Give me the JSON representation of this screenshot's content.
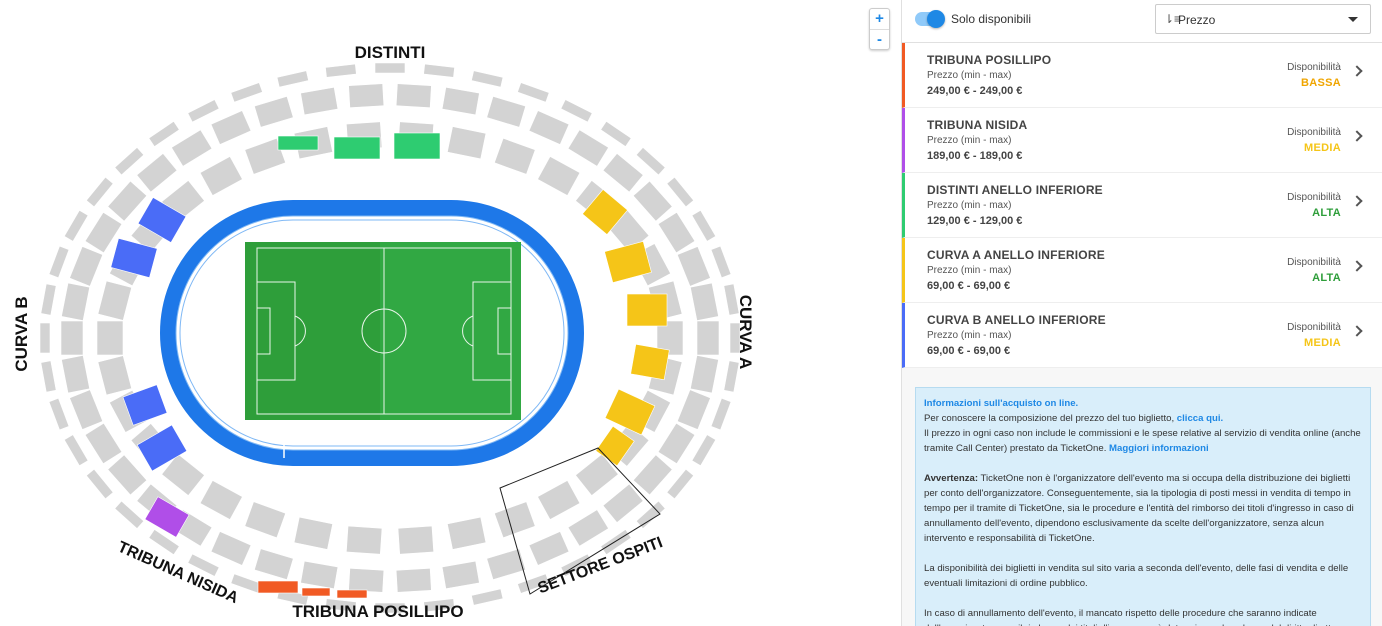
{
  "map": {
    "labels": {
      "distinti": "DISTINTI",
      "curva_b": "CURVA B",
      "curva_a": "CURVA A",
      "tribuna_nisida": "TRIBUNA NISIDA",
      "tribuna_posillipo": "TRIBUNA POSILLIPO",
      "settore_ospiti": "SETTORE OSPITI"
    },
    "zoom_in": "+",
    "zoom_out": "-",
    "colors": {
      "unavailable": "#d3d3d3",
      "distinti": "#2ecc71",
      "curva_a": "#f5c518",
      "curva_b": "#4a6cf7",
      "nisida": "#b04ee8",
      "posillipo": "#f15a24",
      "track": "#1e78e8",
      "pitch": "#2e9e3a"
    }
  },
  "filters": {
    "only_available_label": "Solo disponibili",
    "only_available_on": true,
    "sort_icon": "sort-icon",
    "sort_value": "Prezzo"
  },
  "sectors": [
    {
      "name": "TRIBUNA POSILLIPO",
      "price_label": "Prezzo (min - max)",
      "price": "249,00 € - 249,00 €",
      "avail_label": "Disponibilità",
      "avail": "BASSA",
      "avail_color": "#f0a500",
      "accent": "#f15a24"
    },
    {
      "name": "TRIBUNA NISIDA",
      "price_label": "Prezzo (min - max)",
      "price": "189,00 € - 189,00 €",
      "avail_label": "Disponibilità",
      "avail": "MEDIA",
      "avail_color": "#f5c518",
      "accent": "#b04ee8"
    },
    {
      "name": "DISTINTI ANELLO INFERIORE",
      "price_label": "Prezzo (min - max)",
      "price": "129,00 € - 129,00 €",
      "avail_label": "Disponibilità",
      "avail": "ALTA",
      "avail_color": "#2e9e3a",
      "accent": "#2ecc71"
    },
    {
      "name": "CURVA A ANELLO INFERIORE",
      "price_label": "Prezzo (min - max)",
      "price": "69,00 € - 69,00 €",
      "avail_label": "Disponibilità",
      "avail": "ALTA",
      "avail_color": "#2e9e3a",
      "accent": "#f5c518"
    },
    {
      "name": "CURVA B ANELLO INFERIORE",
      "price_label": "Prezzo (min - max)",
      "price": "69,00 € - 69,00 €",
      "avail_label": "Disponibilità",
      "avail": "MEDIA",
      "avail_color": "#f5c518",
      "accent": "#4a6cf7"
    }
  ],
  "info": {
    "heading": "Informazioni sull'acquisto on line.",
    "p1_text": "Per conoscere la composizione del prezzo del tuo biglietto, ",
    "p1_link": "clicca qui.",
    "p2_text": "Il prezzo in ogni caso non include le commissioni e le spese relative al servizio di vendita online (anche tramite Call Center) prestato da TicketOne. ",
    "p2_link": "Maggiori informazioni",
    "warn_title": "Avvertenza:",
    "warn_text": " TicketOne non è l'organizzatore dell'evento ma si occupa della distribuzione dei biglietti per conto dell'organizzatore. Conseguentemente, sia la tipologia di posti messi in vendita di tempo in tempo per il tramite di TicketOne, sia le procedure e l'entità del rimborso dei titoli d'ingresso in caso di annullamento dell'evento, dipendono esclusivamente da scelte dell'organizzatore, senza alcun intervento e responsabilità di TicketOne.",
    "p4": "La disponibilità dei biglietti in vendita sul sito varia a seconda dell'evento, delle fasi di vendita e delle eventuali limitazioni di ordine pubblico.",
    "p5": "In caso di annullamento dell'evento, il mancato rispetto delle procedure che saranno indicate dall'organizzatore per il rimborso dei titoli d'ingresso può determinare decadenza dal diritto di ottenere"
  }
}
